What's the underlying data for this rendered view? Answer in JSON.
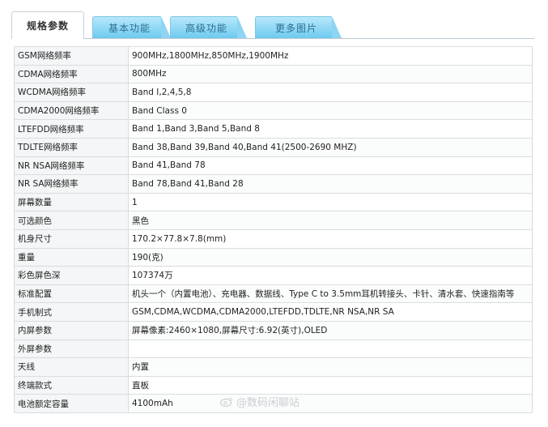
{
  "tabs": [
    {
      "label": "规格参数"
    },
    {
      "label": "基本功能"
    },
    {
      "label": "高级功能"
    },
    {
      "label": "更多图片"
    }
  ],
  "specs": [
    {
      "key": "GSM网络频率",
      "value": "900MHz,1800MHz,850MHz,1900MHz"
    },
    {
      "key": "CDMA网络频率",
      "value": "800MHz"
    },
    {
      "key": "WCDMA网络频率",
      "value": "Band I,2,4,5,8"
    },
    {
      "key": "CDMA2000网络频率",
      "value": "Band Class 0"
    },
    {
      "key": "LTEFDD网络频率",
      "value": "Band 1,Band 3,Band 5,Band 8"
    },
    {
      "key": "TDLTE网络频率",
      "value": "Band 38,Band 39,Band 40,Band 41(2500-2690 MHZ)"
    },
    {
      "key": "NR NSA网络频率",
      "value": "Band 41,Band 78"
    },
    {
      "key": "NR SA网络频率",
      "value": "Band 78,Band 41,Band 28"
    },
    {
      "key": "屏幕数量",
      "value": "1"
    },
    {
      "key": "可选颜色",
      "value": "黑色"
    },
    {
      "key": "机身尺寸",
      "value": "170.2×77.8×7.8(mm)"
    },
    {
      "key": "重量",
      "value": "190(克)"
    },
    {
      "key": "彩色屏色深",
      "value": "107374万"
    },
    {
      "key": "标准配置",
      "value": "机头一个（内置电池）、充电器、数据线、Type C to 3.5mm耳机转接头、卡针、清水套、快速指南等"
    },
    {
      "key": "手机制式",
      "value": "GSM,CDMA,WCDMA,CDMA2000,LTEFDD,TDLTE,NR NSA,NR SA"
    },
    {
      "key": "内屏参数",
      "value": "屏幕像素:2460×1080,屏幕尺寸:6.92(英寸),OLED"
    },
    {
      "key": "外屏参数",
      "value": ""
    },
    {
      "key": "天线",
      "value": "内置"
    },
    {
      "key": "终端款式",
      "value": "直板"
    },
    {
      "key": "电池额定容量",
      "value": "4100mAh"
    }
  ],
  "watermark": {
    "text": "@数码闲聊站",
    "icon": "weibo-icon"
  }
}
